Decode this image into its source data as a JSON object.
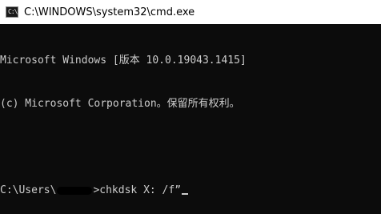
{
  "window": {
    "title": "C:\\WINDOWS\\system32\\cmd.exe",
    "icon": "cmd-icon",
    "icon_glyph": "C:\\"
  },
  "console": {
    "header_line_1": "Microsoft Windows [版本 10.0.19043.1415]",
    "header_line_2": "(c) Microsoft Corporation。保留所有权利。",
    "prompt_prefix": "C:\\Users\\",
    "prompt_suffix": ">",
    "command": "chkdsk X: /f”"
  },
  "colors": {
    "console_background": "#0c0c0c",
    "console_text": "#cccccc",
    "titlebar_background": "#ffffff"
  }
}
